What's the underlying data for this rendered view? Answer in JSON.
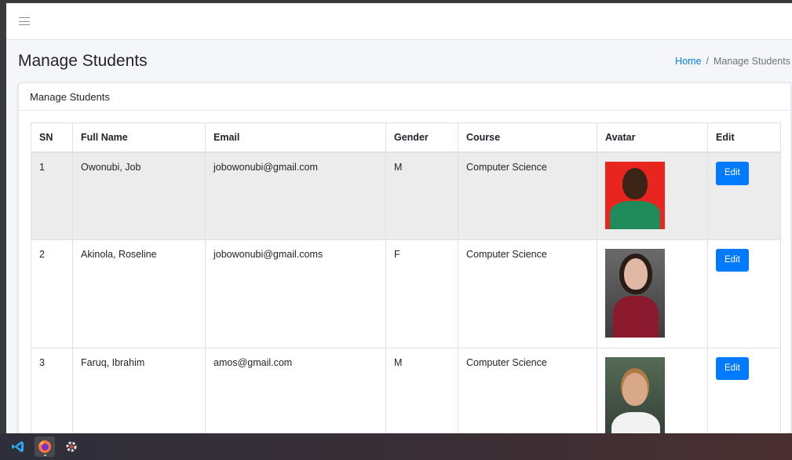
{
  "header": {
    "menu_icon": "hamburger-icon",
    "page_title": "Manage Students",
    "breadcrumb": {
      "home": "Home",
      "separator": "/",
      "current": "Manage Students"
    }
  },
  "card": {
    "title": "Manage Students",
    "table": {
      "columns": [
        "SN",
        "Full Name",
        "Email",
        "Gender",
        "Course",
        "Avatar",
        "Edit"
      ],
      "rows": [
        {
          "sn": "1",
          "name": "Owonubi, Job",
          "email": "jobowonubi@gmail.com",
          "gender": "M",
          "course": "Computer Science",
          "avatar": "avatar-photo-job",
          "edit": "Edit"
        },
        {
          "sn": "2",
          "name": "Akinola, Roseline",
          "email": "jobowonubi@gmail.coms",
          "gender": "F",
          "course": "Computer Science",
          "avatar": "avatar-photo-roseline",
          "edit": "Edit"
        },
        {
          "sn": "3",
          "name": "Faruq, Ibrahim",
          "email": "amos@gmail.com",
          "gender": "M",
          "course": "Computer Science",
          "avatar": "avatar-photo-ibrahim",
          "edit": "Edit"
        }
      ]
    }
  },
  "colors": {
    "primary": "#007bff",
    "stripe": "#ececec",
    "page_bg": "#f4f6f9"
  },
  "taskbar": {
    "icons": [
      "vscode-icon",
      "firefox-icon",
      "settings-gear-icon"
    ]
  }
}
